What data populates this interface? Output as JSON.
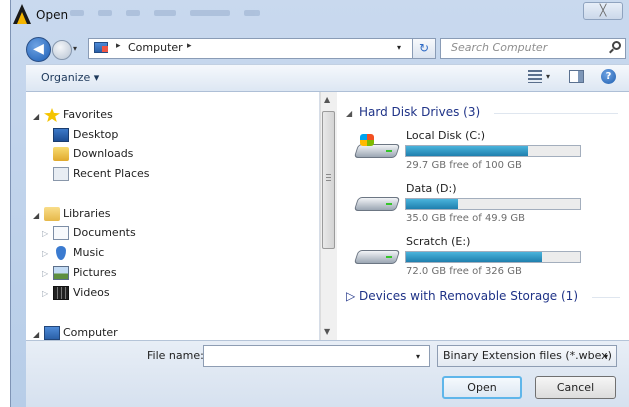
{
  "window": {
    "title": "Open",
    "close_glyph": "╳",
    "app_icon": "app-logo-icon"
  },
  "address": {
    "breadcrumb": [
      "Computer"
    ],
    "separator_glyph": "▸",
    "dropdown_glyph": "▾",
    "refresh_glyph": "↻",
    "back_glyph": "◀"
  },
  "search": {
    "placeholder": "Search Computer"
  },
  "toolbar": {
    "organize_label": "Organize ▾",
    "views_arrow": "▾",
    "help_glyph": "?"
  },
  "nav": {
    "expanded_glyph": "◢",
    "collapsed_glyph": "▷",
    "favorites": {
      "label": "Favorites",
      "items": [
        "Desktop",
        "Downloads",
        "Recent Places"
      ]
    },
    "libraries": {
      "label": "Libraries",
      "items": [
        "Documents",
        "Music",
        "Pictures",
        "Videos"
      ]
    },
    "computer": {
      "label": "Computer"
    },
    "scroll_up_glyph": "▲",
    "scroll_down_glyph": "▼"
  },
  "content": {
    "hard_disk_group": {
      "label": "Hard Disk Drives (3)",
      "expanded_glyph": "◢"
    },
    "drives": [
      {
        "name": "Local Disk (C:)",
        "free_text": "29.7 GB free of 100 GB",
        "used_fraction": 0.703,
        "is_system": true
      },
      {
        "name": "Data (D:)",
        "free_text": "35.0 GB free of 49.9 GB",
        "used_fraction": 0.299,
        "is_system": false
      },
      {
        "name": "Scratch (E:)",
        "free_text": "72.0 GB free of 326 GB",
        "used_fraction": 0.779,
        "is_system": false
      }
    ],
    "removable_group": {
      "label": "▷ Devices with Removable Storage (1)"
    }
  },
  "bottom": {
    "filename_label": "File name:",
    "filename_value": "",
    "filename_dropdown_glyph": "▾",
    "filter_value": "Binary Extension files (*.wbex)",
    "filter_dropdown_glyph": "▾",
    "open_label": "Open",
    "cancel_label": "Cancel"
  }
}
